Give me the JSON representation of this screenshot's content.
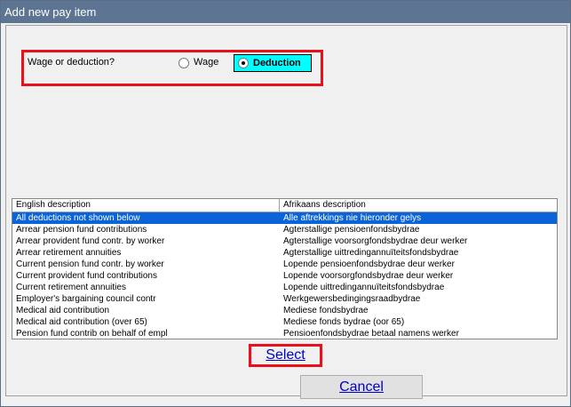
{
  "window": {
    "title": "Add new pay item"
  },
  "question": {
    "label": "Wage or deduction?",
    "options": [
      {
        "label": "Wage",
        "selected": false
      },
      {
        "label": "Deduction",
        "selected": true
      }
    ]
  },
  "list": {
    "columns": [
      "English description",
      "Afrikaans description"
    ],
    "rows": [
      {
        "en": "All deductions not shown below",
        "af": "Alle aftrekkings nie hieronder gelys",
        "selected": true
      },
      {
        "en": "Arrear pension fund contributions",
        "af": "Agterstallige pensioenfondsbydrae"
      },
      {
        "en": "Arrear provident fund contr. by worker",
        "af": "Agterstallige voorsorgfondsbydrae deur werker"
      },
      {
        "en": "Arrear retirement annuities",
        "af": "Agterstallige uittredingannuïteitsfondsbydrae"
      },
      {
        "en": "Current pension fund contr. by worker",
        "af": "Lopende pensioenfondsbydrae deur werker"
      },
      {
        "en": "Current provident fund contributions",
        "af": "Lopende voorsorgfondsbydrae deur werker"
      },
      {
        "en": "Current retirement annuities",
        "af": "Lopende uittredingannuïteitsfondsbydrae"
      },
      {
        "en": "Employer's bargaining council contr",
        "af": "Werkgewersbedingingsraadbydrae"
      },
      {
        "en": "Medical aid contribution",
        "af": "Mediese fondsbydrae"
      },
      {
        "en": "Medical aid contribution (over 65)",
        "af": "Mediese fonds bydrae (oor 65)"
      },
      {
        "en": "Pension fund contrib on behalf of empl",
        "af": "Pensioenfondsbydrae betaal namens werker"
      }
    ]
  },
  "buttons": {
    "select": "Select",
    "cancel": "Cancel"
  },
  "colors": {
    "highlight": "#e8101a",
    "selection": "#0a64d8",
    "deduction_bg": "#00ffff"
  }
}
